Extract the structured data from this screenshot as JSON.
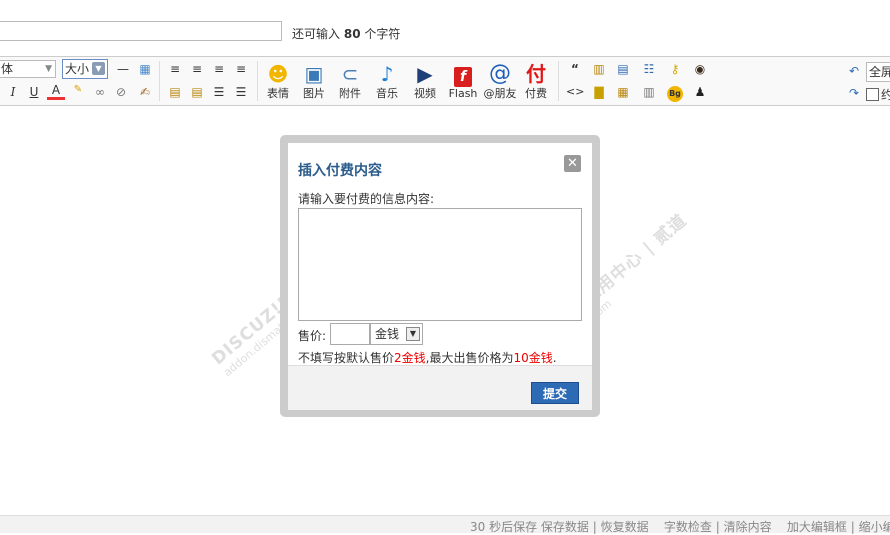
{
  "subject": {
    "char_prefix": "还可输入",
    "char_count": "80",
    "char_suffix": "个字符"
  },
  "toolbar": {
    "font_label": "体",
    "size_label": "大小",
    "buttons": [
      {
        "label": "表情",
        "icon": "smiley-icon"
      },
      {
        "label": "图片",
        "icon": "image-icon"
      },
      {
        "label": "附件",
        "icon": "paperclip-icon"
      },
      {
        "label": "音乐",
        "icon": "music-note-icon"
      },
      {
        "label": "视频",
        "icon": "video-clapper-icon"
      },
      {
        "label": "Flash",
        "icon": "flash-icon"
      },
      {
        "label": "@朋友",
        "icon": "at-icon"
      },
      {
        "label": "付费",
        "icon": "pay-icon"
      }
    ],
    "right_label": "全屏",
    "right_label2": "约"
  },
  "watermark": {
    "brand": "DISCUZ!应用中心 | 贰道",
    "url": "addon.dismall.com"
  },
  "dialog": {
    "title": "插入付费内容",
    "prompt": "请输入要付费的信息内容:",
    "price_label": "售价:",
    "unit": "金钱",
    "hint_prefix": "不填写按默认售价",
    "default_price": "2金钱",
    "hint_mid": ",最大出售价格为",
    "max_price": "10金钱",
    "hint_end": ".",
    "submit": "提交"
  },
  "statusbar": {
    "autosave": "30 秒后保存",
    "save": "保存数据",
    "restore": "恢复数据",
    "check": "字数检查",
    "clear": "清除内容",
    "enlarge": "加大编辑框",
    "shrink": "缩小编"
  }
}
